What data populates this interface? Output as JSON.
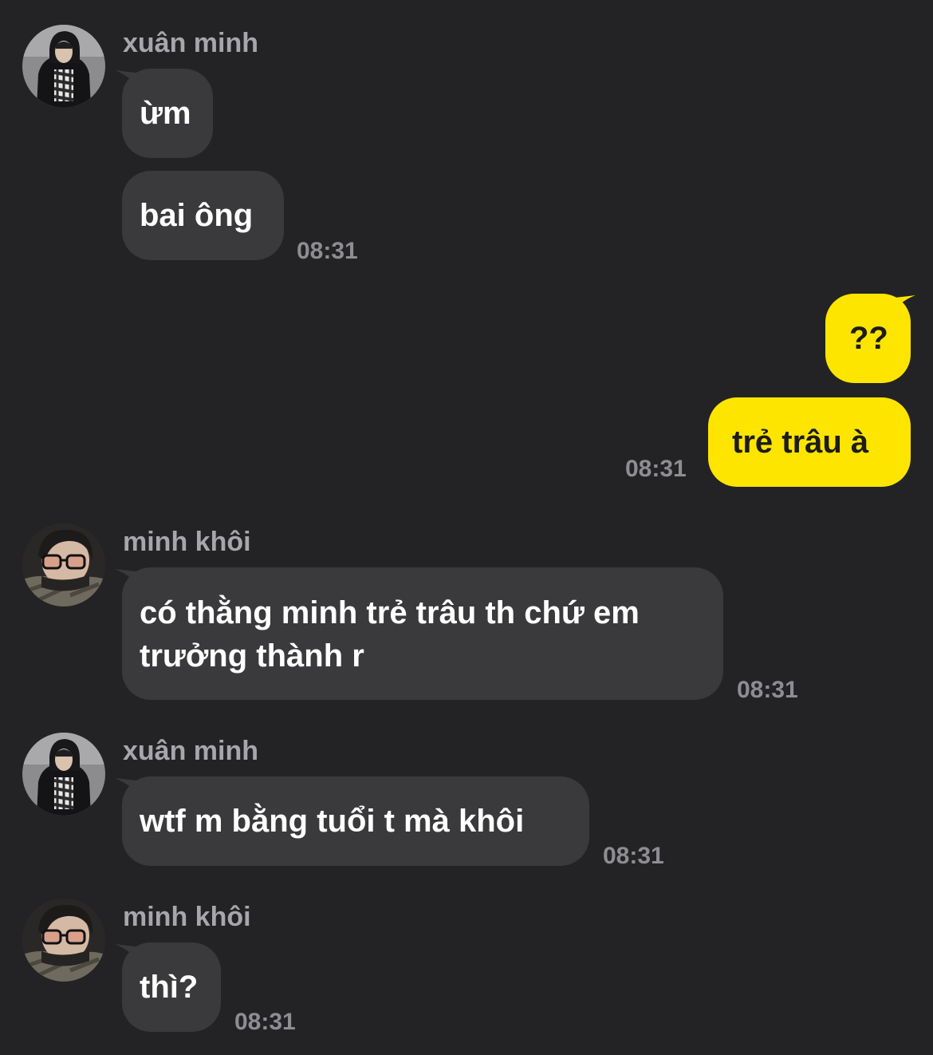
{
  "colors": {
    "background": "#232325",
    "incoming_bubble": "#3a3a3c",
    "outgoing_bubble": "#fee500",
    "sender_name": "#a7a7ab",
    "timestamp": "#8d8d92"
  },
  "messages": [
    {
      "sender": "xuân minh",
      "avatar_icon": "profile-photo-hooded",
      "bubbles": [
        "ừm",
        "bai ông"
      ],
      "time": "08:31"
    },
    {
      "sender": "",
      "outgoing": true,
      "bubbles": [
        "??",
        "trẻ trâu à"
      ],
      "time": "08:31"
    },
    {
      "sender": "minh khôi",
      "avatar_icon": "profile-photo-glasses",
      "bubbles": [
        "có thằng minh trẻ trâu th chứ em trưởng thành r"
      ],
      "time": "08:31"
    },
    {
      "sender": "xuân minh",
      "avatar_icon": "profile-photo-hooded",
      "bubbles": [
        "wtf m bằng tuổi t mà khôi"
      ],
      "time": "08:31"
    },
    {
      "sender": "minh khôi",
      "avatar_icon": "profile-photo-glasses",
      "bubbles": [
        "thì?"
      ],
      "time": "08:31"
    }
  ]
}
